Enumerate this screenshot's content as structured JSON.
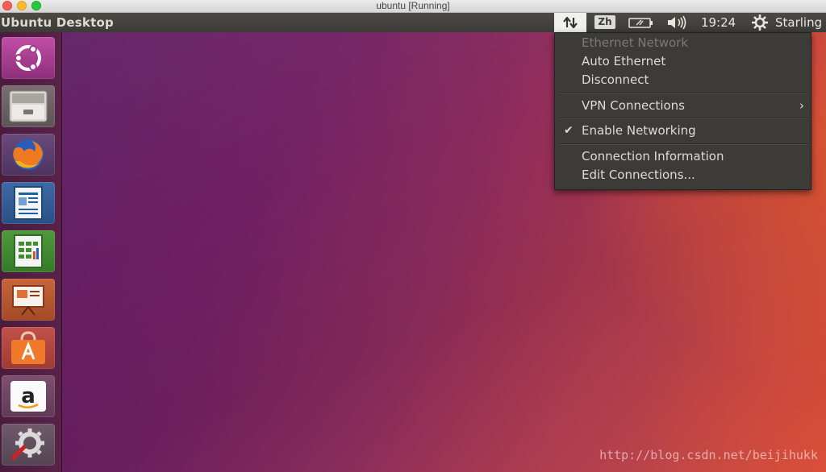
{
  "host_window": {
    "title": "ubuntu [Running]"
  },
  "panel": {
    "title": "Ubuntu Desktop",
    "indicators": {
      "network_icon": "network-updown-icon",
      "input_method": "Zh",
      "battery_icon": "battery-icon",
      "volume_icon": "volume-icon",
      "time": "19:24",
      "settings_icon": "gear-icon",
      "user": "Starling"
    }
  },
  "network_menu": {
    "header": "Ethernet Network",
    "items": {
      "auto_ethernet": "Auto Ethernet",
      "disconnect": "Disconnect",
      "vpn": "VPN Connections",
      "enable_networking": "Enable Networking",
      "connection_info": "Connection Information",
      "edit_connections": "Edit Connections..."
    },
    "enable_networking_checked": true
  },
  "launcher": {
    "items": [
      "ubuntu-dash-icon",
      "files-icon",
      "firefox-icon",
      "writer-icon",
      "calc-icon",
      "impress-icon",
      "software-center-icon",
      "amazon-icon",
      "system-settings-icon"
    ]
  },
  "desktop": {
    "watermark": "http://blog.csdn.net/beijihukk"
  },
  "colors": {
    "panel": "#3c3b37",
    "menu": "#3c3b37",
    "launcher": "#4a1c3e",
    "accent": "#e95420"
  }
}
